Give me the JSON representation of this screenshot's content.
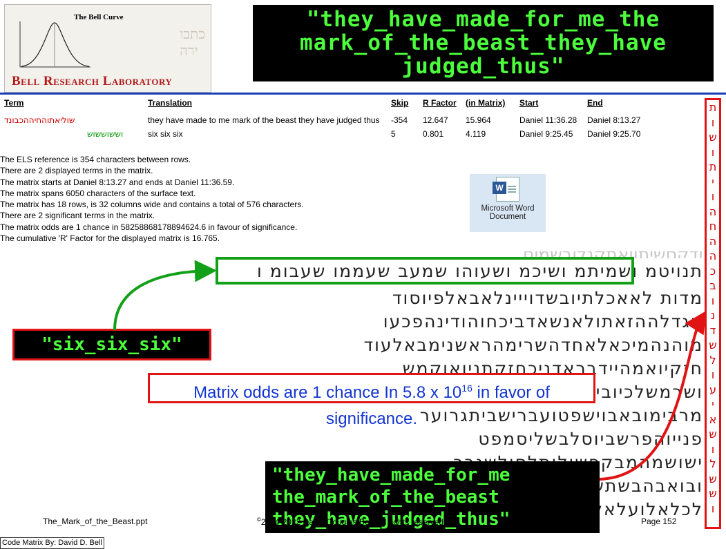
{
  "header": {
    "logo_chart_title": "The Bell Curve",
    "logo_text": "Bell Research Laboratory",
    "title_lines": [
      "\"they_have_made_for_me_the",
      "mark_of_the_beast_they_have",
      "judged_thus\""
    ]
  },
  "table": {
    "headers": [
      "Term",
      "Translation",
      "Skip",
      "R Factor",
      "(in Matrix)",
      "Start",
      "End"
    ],
    "rows": [
      {
        "term": "שוליאתוהחיההכבונד",
        "translation": "they have made to me mark of the beast they have judged thus",
        "skip": "-354",
        "r_factor": "12.647",
        "in_matrix": "15.964",
        "start": "Daniel 11:36.28",
        "end": "Daniel 8:13.27"
      },
      {
        "term": "וששוששוש",
        "translation": "six six six",
        "skip": "5",
        "r_factor": "0.801",
        "in_matrix": "4.119",
        "start": "Daniel 9:25.45",
        "end": "Daniel 9:25.70"
      }
    ]
  },
  "info_lines": [
    "The ELS reference is 354 characters between rows.",
    "There are 2 displayed terms in the matrix.",
    "The matrix starts at Daniel 8:13.27 and ends at Daniel 11:36.59.",
    "The matrix spans 6050 characters of the surface text.",
    "The matrix has 18 rows, is 32 columns wide and contains a total of 576 characters.",
    "There are 2 significant terms in the matrix.",
    "The matrix odds are 1 chance in 58258868178894624.6 in favour of significance.",
    "The cumulative 'R' Factor for the displayed matrix is 16.765."
  ],
  "word_icon": {
    "label_line1": "Microsoft Word",
    "label_line2": "Document",
    "icon": "word-document-icon"
  },
  "matrix_rows": [
    "תנויטמ ושמיתמ ושיכמ ושעוהו שמעב שעממו שעבומ ו",
    "מדות לאאכלתיובשדוייינלאבאלפיוסוד",
    "הגדלההזאתולאנשאדביכחוהודינהפכעו",
    "מוהנהמיכאלאחדהשרימהראשנימבאלעוד",
    "חזקיואמהיידבראדניכחזקתניואוקמש",
    "ושרמשלכיובייחזקאלושמאתרבואלשמ",
    "מרבימובאבוישפטועברישביתגרוער",
    "פנייוהפרשביוסלבשליסמפט",
    "ישושמהמבקפשולותלסולשנבר",
    "ובואבהבשתשעויהימיאשפוני",
    "לכלאלועלאלאלימידברנפלאותהצליחע"
  ],
  "right_column_letters": [
    "ת",
    "ו",
    "ש",
    "ו",
    "ת",
    "י",
    "ו",
    "ה",
    "ח",
    "ה",
    "ה",
    "כ",
    "ב",
    "ו",
    "נ",
    "ד",
    "ש",
    "ל",
    "ו",
    "ע",
    "י",
    "א",
    "ש",
    "ו",
    "ל",
    "ש",
    "ש",
    "ו"
  ],
  "six_label": "\"six_six_six\"",
  "odds_text": "Matrix odds are 1 chance In 5.8 x 10",
  "odds_exp": "16",
  "odds_tail": " in favor of significance.",
  "phrase_lines": [
    "\"they_have_made_for_me",
    "the_mark_of_the_beast",
    "they_have_judged_thus\""
  ],
  "footer": {
    "file": "The_Mark_of_the_Beast.ppt",
    "copyright_sym": "©",
    "copyright": "2004-2022 David Douglas Bell, All rights reserved",
    "page": "Page 152",
    "credit": "Code Matrix By: David D. Bell"
  },
  "colors": {
    "green_text": "#4cff3c",
    "red_border": "#e01414",
    "blue_text": "#1234d0",
    "frame_green": "#13a019"
  }
}
